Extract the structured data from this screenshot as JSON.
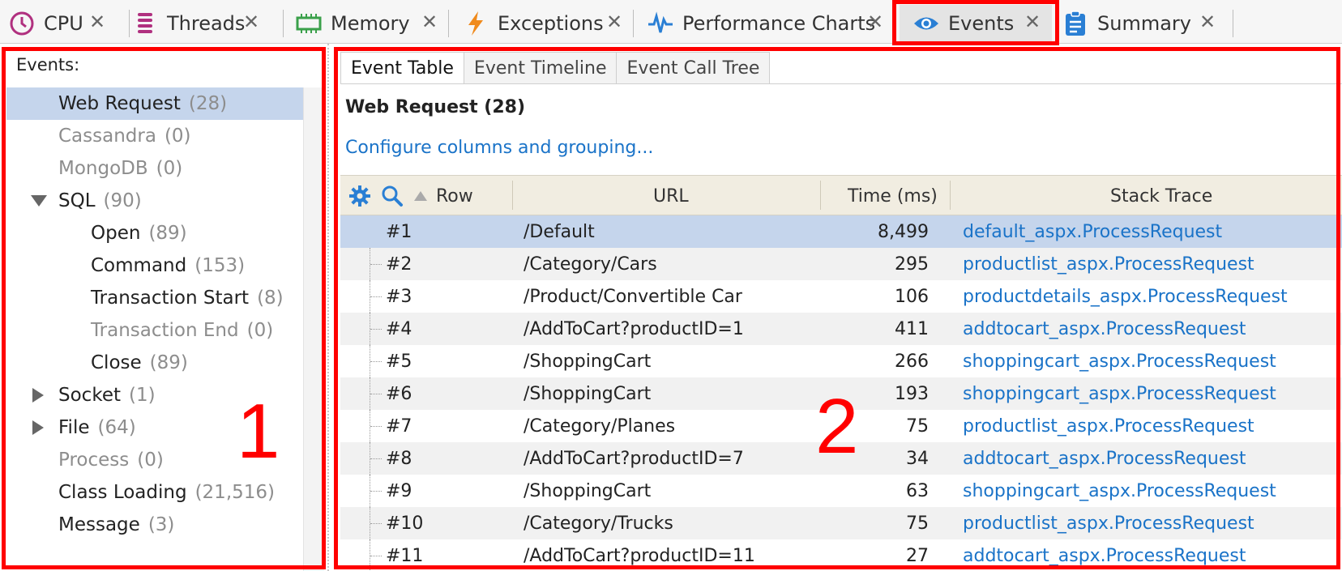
{
  "tabs": [
    {
      "label": "CPU",
      "icon": "cpu-clock-icon",
      "active": false
    },
    {
      "label": "Threads",
      "icon": "threads-icon",
      "active": false
    },
    {
      "label": "Memory",
      "icon": "memory-chip-icon",
      "active": false
    },
    {
      "label": "Exceptions",
      "icon": "lightning-icon",
      "active": false
    },
    {
      "label": "Performance Charts",
      "icon": "pulse-chart-icon",
      "active": false
    },
    {
      "label": "Events",
      "icon": "eye-icon",
      "active": true
    },
    {
      "label": "Summary",
      "icon": "clipboard-icon",
      "active": false
    }
  ],
  "tab_close_glyph": "✕",
  "left": {
    "header": "Events:",
    "items": [
      {
        "name": "Web Request",
        "count": "(28)",
        "dim": false,
        "selected": true
      },
      {
        "name": "Cassandra",
        "count": "(0)",
        "dim": true
      },
      {
        "name": "MongoDB",
        "count": "(0)",
        "dim": true
      },
      {
        "name": "SQL",
        "count": "(90)",
        "dim": false,
        "expander": "down"
      },
      {
        "name": "Open",
        "count": "(89)",
        "dim": false,
        "child": true
      },
      {
        "name": "Command",
        "count": "(153)",
        "dim": false,
        "child": true
      },
      {
        "name": "Transaction Start",
        "count": "(8)",
        "dim": false,
        "child": true
      },
      {
        "name": "Transaction End",
        "count": "(0)",
        "dim": true,
        "child": true
      },
      {
        "name": "Close",
        "count": "(89)",
        "dim": false,
        "child": true
      },
      {
        "name": "Socket",
        "count": "(1)",
        "dim": false,
        "expander": "right"
      },
      {
        "name": "File",
        "count": "(64)",
        "dim": false,
        "expander": "right"
      },
      {
        "name": "Process",
        "count": "(0)",
        "dim": true
      },
      {
        "name": "Class Loading",
        "count": "(21,516)",
        "dim": false
      },
      {
        "name": "Message",
        "count": "(3)",
        "dim": false
      }
    ]
  },
  "right": {
    "subtabs": [
      "Event Table",
      "Event Timeline",
      "Event Call Tree"
    ],
    "title": "Web Request (28)",
    "config_link": "Configure columns and grouping...",
    "columns": {
      "row": "Row",
      "url": "URL",
      "time": "Time (ms)",
      "stack": "Stack Trace"
    },
    "rows": [
      {
        "row": "#1",
        "url": "/Default",
        "time": "8,499",
        "stack": "default_aspx.ProcessRequest"
      },
      {
        "row": "#2",
        "url": "/Category/Cars",
        "time": "295",
        "stack": "productlist_aspx.ProcessRequest"
      },
      {
        "row": "#3",
        "url": "/Product/Convertible Car",
        "time": "106",
        "stack": "productdetails_aspx.ProcessRequest"
      },
      {
        "row": "#4",
        "url": "/AddToCart?productID=1",
        "time": "411",
        "stack": "addtocart_aspx.ProcessRequest"
      },
      {
        "row": "#5",
        "url": "/ShoppingCart",
        "time": "266",
        "stack": "shoppingcart_aspx.ProcessRequest"
      },
      {
        "row": "#6",
        "url": "/ShoppingCart",
        "time": "193",
        "stack": "shoppingcart_aspx.ProcessRequest"
      },
      {
        "row": "#7",
        "url": "/Category/Planes",
        "time": "75",
        "stack": "productlist_aspx.ProcessRequest"
      },
      {
        "row": "#8",
        "url": "/AddToCart?productID=7",
        "time": "34",
        "stack": "addtocart_aspx.ProcessRequest"
      },
      {
        "row": "#9",
        "url": "/ShoppingCart",
        "time": "63",
        "stack": "shoppingcart_aspx.ProcessRequest"
      },
      {
        "row": "#10",
        "url": "/Category/Trucks",
        "time": "75",
        "stack": "productlist_aspx.ProcessRequest"
      },
      {
        "row": "#11",
        "url": "/AddToCart?productID=11",
        "time": "27",
        "stack": "addtocart_aspx.ProcessRequest"
      }
    ]
  },
  "annotations": {
    "one": "1",
    "two": "2"
  },
  "colors": {
    "highlight_red": "#ff0000",
    "link_blue": "#1a73c8",
    "selection": "#c5d5ec"
  }
}
